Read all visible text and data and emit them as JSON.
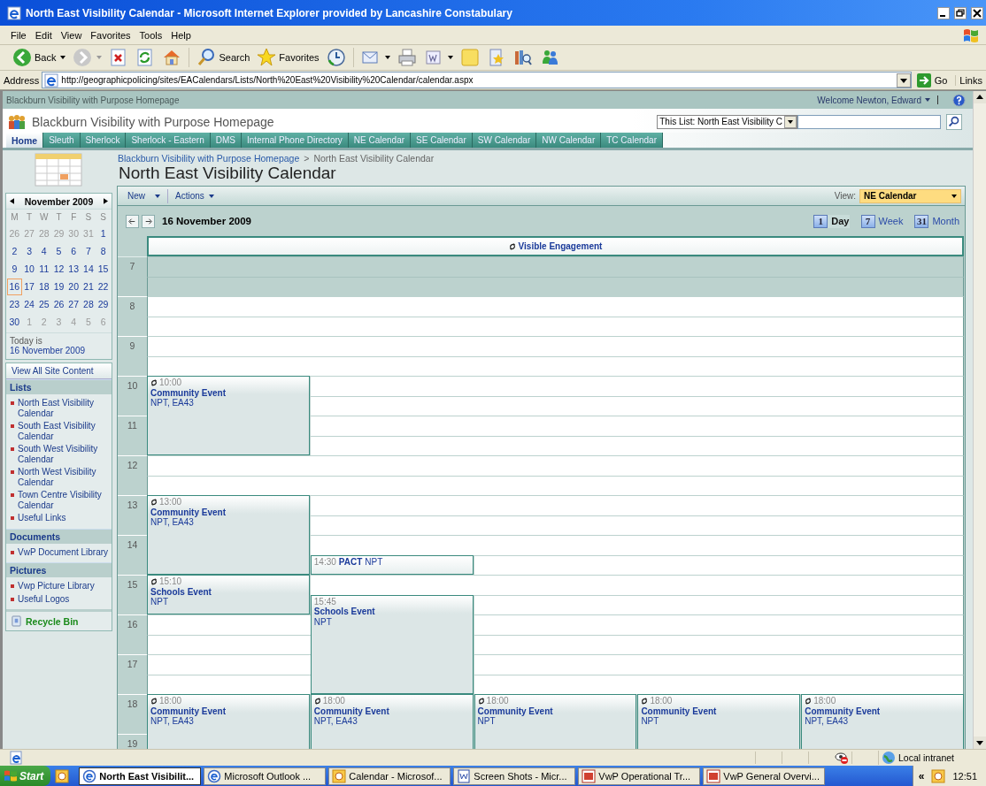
{
  "window": {
    "title": "North East Visibility Calendar - Microsoft Internet Explorer provided by Lancashire Constabulary"
  },
  "menu": [
    "File",
    "Edit",
    "View",
    "Favorites",
    "Tools",
    "Help"
  ],
  "toolbar": [
    {
      "kind": "back",
      "label": "Back"
    },
    {
      "kind": "forward"
    },
    {
      "kind": "stop"
    },
    {
      "kind": "refresh"
    },
    {
      "kind": "home"
    },
    {
      "kind": "separator"
    },
    {
      "kind": "search",
      "label": "Search"
    },
    {
      "kind": "favorites",
      "label": "Favorites"
    },
    {
      "kind": "history"
    },
    {
      "kind": "separator"
    },
    {
      "kind": "mail"
    },
    {
      "kind": "print"
    },
    {
      "kind": "word"
    },
    {
      "kind": "note"
    },
    {
      "kind": "research"
    },
    {
      "kind": "library"
    },
    {
      "kind": "messenger"
    }
  ],
  "address": {
    "label": "Address",
    "url": "http://geographicpolicing/sites/EACalendars/Lists/North%20East%20Visibility%20Calendar/calendar.aspx",
    "go": "Go",
    "links": "Links"
  },
  "site": {
    "top_title": "Blackburn Visibility with Purpose Homepage",
    "welcome": "Welcome Newton, Edward",
    "title": "Blackburn Visibility with Purpose Homepage",
    "search_scope": "This List: North East Visibility C"
  },
  "tabs": [
    {
      "label": "Home",
      "selected": true
    },
    {
      "label": "Sleuth",
      "selected": false
    },
    {
      "label": "Sherlock",
      "selected": false
    },
    {
      "label": "Sherlock - Eastern",
      "selected": false
    },
    {
      "label": "DMS",
      "selected": false
    },
    {
      "label": "Internal Phone Directory",
      "selected": false
    },
    {
      "label": "NE Calendar",
      "selected": false
    },
    {
      "label": "SE Calendar",
      "selected": false
    },
    {
      "label": "SW Calendar",
      "selected": false
    },
    {
      "label": "NW Calendar",
      "selected": false
    },
    {
      "label": "TC Calendar",
      "selected": false
    }
  ],
  "breadcrumb": {
    "parent": "Blackburn Visibility with Purpose Homepage",
    "separator": ">",
    "current": "North East Visibility Calendar"
  },
  "page_title": "North East Visibility Calendar",
  "date_picker": {
    "month": "November 2009",
    "weekdays": [
      "M",
      "T",
      "W",
      "T",
      "F",
      "S",
      "S"
    ],
    "weeks": [
      [
        {
          "day": "26",
          "other_month": true,
          "selected": false
        },
        {
          "day": "27",
          "other_month": true,
          "selected": false
        },
        {
          "day": "28",
          "other_month": true,
          "selected": false
        },
        {
          "day": "29",
          "other_month": true,
          "selected": false
        },
        {
          "day": "30",
          "other_month": true,
          "selected": false
        },
        {
          "day": "31",
          "other_month": true,
          "selected": false
        },
        {
          "day": "1",
          "other_month": false,
          "selected": false
        }
      ],
      [
        {
          "day": "2",
          "other_month": false,
          "selected": false
        },
        {
          "day": "3",
          "other_month": false,
          "selected": false
        },
        {
          "day": "4",
          "other_month": false,
          "selected": false
        },
        {
          "day": "5",
          "other_month": false,
          "selected": false
        },
        {
          "day": "6",
          "other_month": false,
          "selected": false
        },
        {
          "day": "7",
          "other_month": false,
          "selected": false
        },
        {
          "day": "8",
          "other_month": false,
          "selected": false
        }
      ],
      [
        {
          "day": "9",
          "other_month": false,
          "selected": false
        },
        {
          "day": "10",
          "other_month": false,
          "selected": false
        },
        {
          "day": "11",
          "other_month": false,
          "selected": false
        },
        {
          "day": "12",
          "other_month": false,
          "selected": false
        },
        {
          "day": "13",
          "other_month": false,
          "selected": false
        },
        {
          "day": "14",
          "other_month": false,
          "selected": false
        },
        {
          "day": "15",
          "other_month": false,
          "selected": false
        }
      ],
      [
        {
          "day": "16",
          "other_month": false,
          "selected": true
        },
        {
          "day": "17",
          "other_month": false,
          "selected": false
        },
        {
          "day": "18",
          "other_month": false,
          "selected": false
        },
        {
          "day": "19",
          "other_month": false,
          "selected": false
        },
        {
          "day": "20",
          "other_month": false,
          "selected": false
        },
        {
          "day": "21",
          "other_month": false,
          "selected": false
        },
        {
          "day": "22",
          "other_month": false,
          "selected": false
        }
      ],
      [
        {
          "day": "23",
          "other_month": false,
          "selected": false
        },
        {
          "day": "24",
          "other_month": false,
          "selected": false
        },
        {
          "day": "25",
          "other_month": false,
          "selected": false
        },
        {
          "day": "26",
          "other_month": false,
          "selected": false
        },
        {
          "day": "27",
          "other_month": false,
          "selected": false
        },
        {
          "day": "28",
          "other_month": false,
          "selected": false
        },
        {
          "day": "29",
          "other_month": false,
          "selected": false
        }
      ],
      [
        {
          "day": "30",
          "other_month": false,
          "selected": false
        },
        {
          "day": "1",
          "other_month": true,
          "selected": false
        },
        {
          "day": "2",
          "other_month": true,
          "selected": false
        },
        {
          "day": "3",
          "other_month": true,
          "selected": false
        },
        {
          "day": "4",
          "other_month": true,
          "selected": false
        },
        {
          "day": "5",
          "other_month": true,
          "selected": false
        },
        {
          "day": "6",
          "other_month": true,
          "selected": false
        }
      ]
    ],
    "today_label": "Today is",
    "today": "16 November 2009"
  },
  "quick_launch": {
    "view_all": "View All Site Content",
    "sections": [
      {
        "title": "Lists",
        "items": [
          "North East Visibility Calendar",
          "South East Visibility Calendar",
          "South West Visibility Calendar",
          "North West Visibility Calendar",
          "Town Centre Visibility Calendar",
          "Useful Links"
        ]
      },
      {
        "title": "Documents",
        "items": [
          "VwP Document Library"
        ]
      },
      {
        "title": "Pictures",
        "items": [
          "Vwp Picture Library",
          "Useful Logos"
        ]
      }
    ],
    "recycle_bin": "Recycle Bin"
  },
  "calendar_toolbar": {
    "new": "New",
    "actions": "Actions",
    "view_label": "View:",
    "view": "NE Calendar"
  },
  "day": {
    "date": "16 November 2009",
    "views": [
      {
        "icon_text": "1",
        "label": "Day",
        "selected": true
      },
      {
        "icon_text": "7",
        "label": "Week",
        "selected": false
      },
      {
        "icon_text": "31",
        "label": "Month",
        "selected": false
      }
    ],
    "all_day": {
      "title": "Visible Engagement",
      "recurring": true
    },
    "hours": [
      {
        "label": "7",
        "shaded": true
      },
      {
        "label": "8",
        "shaded": false
      },
      {
        "label": "9",
        "shaded": false
      },
      {
        "label": "10",
        "shaded": false
      },
      {
        "label": "11",
        "shaded": false
      },
      {
        "label": "12",
        "shaded": false
      },
      {
        "label": "13",
        "shaded": false
      },
      {
        "label": "14",
        "shaded": false
      },
      {
        "label": "15",
        "shaded": false
      },
      {
        "label": "16",
        "shaded": false
      },
      {
        "label": "17",
        "shaded": false
      },
      {
        "label": "18",
        "shaded": false
      },
      {
        "label": "19",
        "shaded": false
      }
    ],
    "lanes": [
      [
        {
          "kind": "block",
          "time": "10:00",
          "title": "Community Event",
          "location": "NPT, EA43",
          "recurring": true
        },
        {
          "kind": "block",
          "time": "13:00",
          "title": "Community Event",
          "location": "NPT, EA43",
          "recurring": true
        },
        {
          "kind": "block",
          "time": "15:10",
          "title": "Schools Event",
          "location": "NPT",
          "recurring": true
        },
        {
          "kind": "block",
          "time": "18:00",
          "title": "Community Event",
          "location": "NPT, EA43",
          "recurring": true
        }
      ],
      [
        {
          "kind": "inline",
          "time": "14:30",
          "title": "PACT",
          "location": "NPT",
          "recurring": false
        },
        {
          "kind": "block",
          "time": "15:45",
          "title": "Schools Event",
          "location": "NPT",
          "recurring": false
        },
        {
          "kind": "block",
          "time": "18:00",
          "title": "Community Event",
          "location": "NPT, EA43",
          "recurring": true
        }
      ],
      [
        {
          "kind": "block",
          "time": "18:00",
          "title": "Community Event",
          "location": "NPT",
          "recurring": true
        }
      ],
      [
        {
          "kind": "block",
          "time": "18:00",
          "title": "Community Event",
          "location": "NPT",
          "recurring": true
        }
      ],
      [
        {
          "kind": "block",
          "time": "18:00",
          "title": "Community Event",
          "location": "NPT, EA43",
          "recurring": true
        }
      ]
    ]
  },
  "status_bar": {
    "zone": "Local intranet"
  },
  "taskbar": {
    "start": "Start",
    "tasks": [
      {
        "kind": "browser",
        "label": "North East Visibilit...",
        "selected": true
      },
      {
        "kind": "browser",
        "label": "Microsoft Outlook ...",
        "selected": false
      },
      {
        "kind": "calendar",
        "label": "Calendar - Microsof...",
        "selected": false
      },
      {
        "kind": "document",
        "label": "Screen Shots - Micr...",
        "selected": false
      },
      {
        "kind": "slides",
        "label": "VwP Operational Tr...",
        "selected": false
      },
      {
        "kind": "slides",
        "label": "VwP General Overvi...",
        "selected": false
      }
    ],
    "tray_expand": "«",
    "clock": "12:51"
  }
}
